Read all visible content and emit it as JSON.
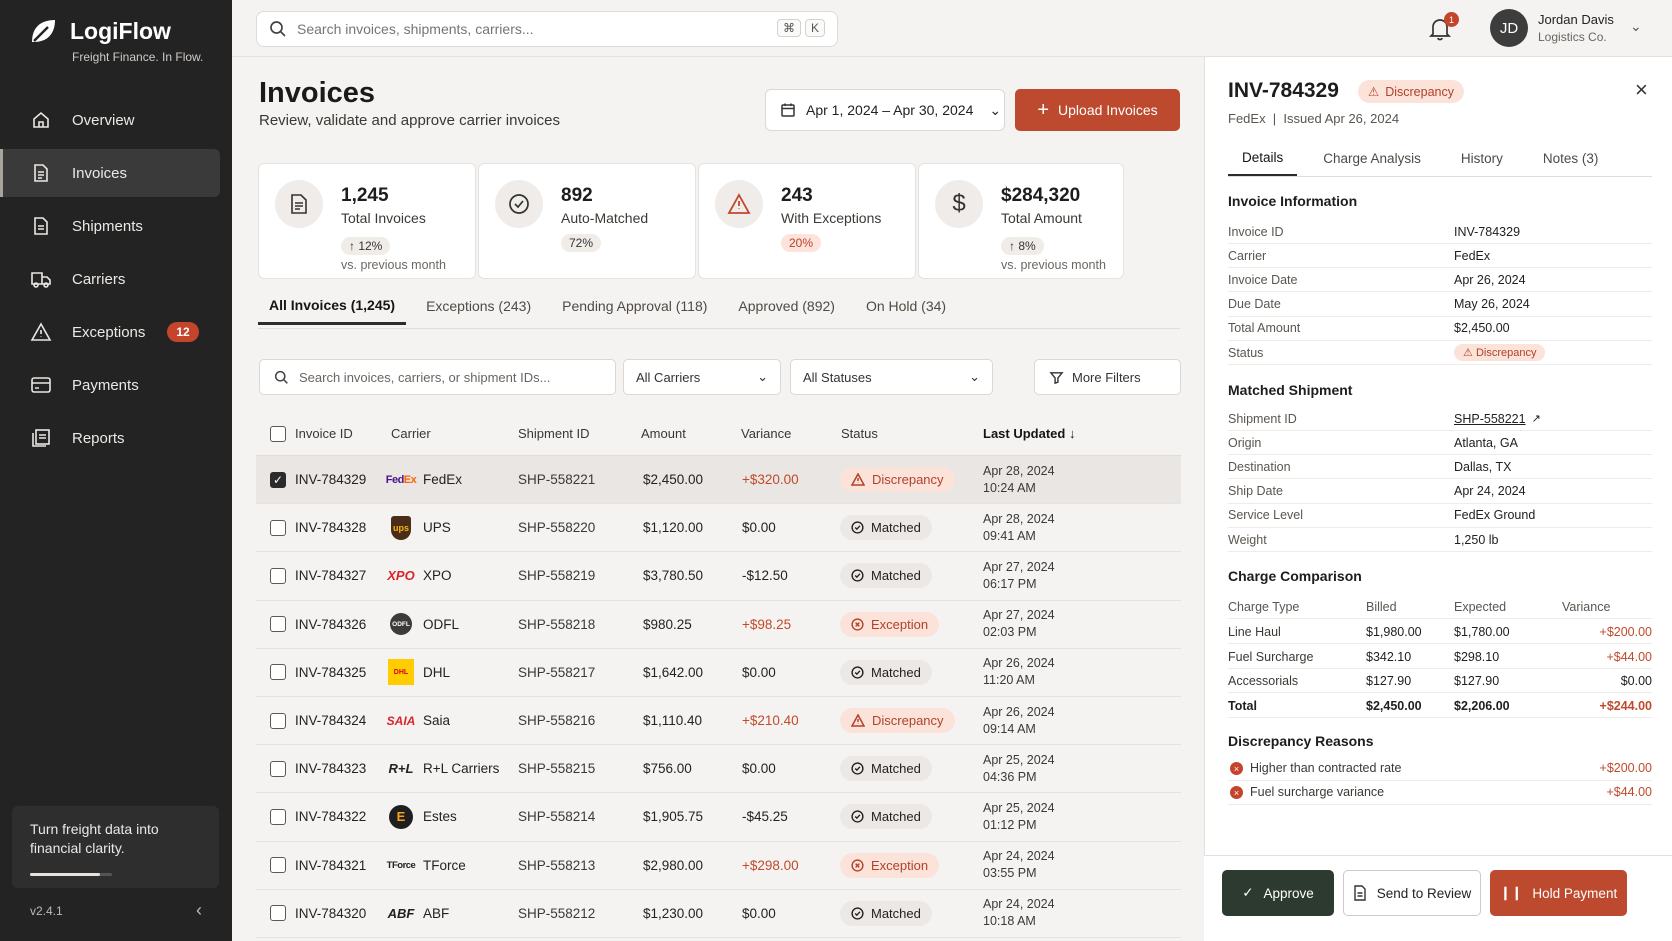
{
  "app": {
    "name": "LogiFlow",
    "tagline": "Freight Finance. In Flow.",
    "version": "v2.4.1",
    "promo": "Turn freight data into financial clarity.",
    "promo_progress": 0.85
  },
  "nav": [
    {
      "label": "Overview",
      "icon": "home-icon"
    },
    {
      "label": "Invoices",
      "icon": "document-icon",
      "active": true
    },
    {
      "label": "Shipments",
      "icon": "clipboard-icon"
    },
    {
      "label": "Carriers",
      "icon": "truck-icon"
    },
    {
      "label": "Exceptions",
      "icon": "warning-icon",
      "badge": "12"
    },
    {
      "label": "Payments",
      "icon": "card-icon"
    },
    {
      "label": "Reports",
      "icon": "reports-icon"
    }
  ],
  "topbar": {
    "search_placeholder": "Search invoices, shipments, carriers...",
    "kbd1": "⌘",
    "kbd2": "K",
    "notif_count": "1",
    "user_initials": "JD",
    "user_name": "Jordan Davis",
    "user_org": "Logistics Co."
  },
  "page": {
    "title": "Invoices",
    "subtitle": "Review, validate and approve carrier invoices",
    "date_range": "Apr 1, 2024 – Apr 30, 2024",
    "upload_label": "Upload Invoices"
  },
  "stats": [
    {
      "value": "1,245",
      "label": "Total Invoices",
      "pill": "↑ 12%",
      "note": "vs. previous month",
      "icon": "document-icon"
    },
    {
      "value": "892",
      "label": "Auto-Matched",
      "pill": "72%",
      "note": "",
      "icon": "check-circle-icon"
    },
    {
      "value": "243",
      "label": "With Exceptions",
      "pill": "20%",
      "note": "",
      "icon": "warning-icon"
    },
    {
      "value": "$284,320",
      "label": "Total Amount",
      "pill": "↑ 8%",
      "note": "vs. previous month",
      "icon": "dollar-icon"
    }
  ],
  "tabs": [
    "All Invoices (1,245)",
    "Exceptions (243)",
    "Pending Approval (118)",
    "Approved (892)",
    "On Hold (34)"
  ],
  "filters": {
    "search_placeholder": "Search invoices, carriers, or shipment IDs...",
    "carriers": "All Carriers",
    "statuses": "All Statuses",
    "more": "More Filters"
  },
  "columns": [
    "Invoice ID",
    "Carrier",
    "Shipment ID",
    "Amount",
    "Variance",
    "Status",
    "Last Updated"
  ],
  "rows": [
    {
      "id": "INV-784329",
      "carrier": "FedEx",
      "logo": "FedEx",
      "shipment": "SHP-558221",
      "amount": "$2,450.00",
      "variance": "+$320.00",
      "status": "Discrepancy",
      "date": "Apr 28, 2024",
      "time": "10:24 AM",
      "selected": true
    },
    {
      "id": "INV-784328",
      "carrier": "UPS",
      "logo": "ups",
      "shipment": "SHP-558220",
      "amount": "$1,120.00",
      "variance": "$0.00",
      "status": "Matched",
      "date": "Apr 28, 2024",
      "time": "09:41 AM"
    },
    {
      "id": "INV-784327",
      "carrier": "XPO",
      "logo": "XPO",
      "shipment": "SHP-558219",
      "amount": "$3,780.50",
      "variance": "-$12.50",
      "status": "Matched",
      "date": "Apr 27, 2024",
      "time": "06:17 PM"
    },
    {
      "id": "INV-784326",
      "carrier": "ODFL",
      "logo": "ODFL",
      "shipment": "SHP-558218",
      "amount": "$980.25",
      "variance": "+$98.25",
      "status": "Exception",
      "date": "Apr 27, 2024",
      "time": "02:03 PM"
    },
    {
      "id": "INV-784325",
      "carrier": "DHL",
      "logo": "DHL",
      "shipment": "SHP-558217",
      "amount": "$1,642.00",
      "variance": "$0.00",
      "status": "Matched",
      "date": "Apr 26, 2024",
      "time": "11:20 AM"
    },
    {
      "id": "INV-784324",
      "carrier": "Saia",
      "logo": "SAIA",
      "shipment": "SHP-558216",
      "amount": "$1,110.40",
      "variance": "+$210.40",
      "status": "Discrepancy",
      "date": "Apr 26, 2024",
      "time": "09:14 AM"
    },
    {
      "id": "INV-784323",
      "carrier": "R+L Carriers",
      "logo": "R+L",
      "shipment": "SHP-558215",
      "amount": "$756.00",
      "variance": "$0.00",
      "status": "Matched",
      "date": "Apr 25, 2024",
      "time": "04:36 PM"
    },
    {
      "id": "INV-784322",
      "carrier": "Estes",
      "logo": "E",
      "shipment": "SHP-558214",
      "amount": "$1,905.75",
      "variance": "-$45.25",
      "status": "Matched",
      "date": "Apr 25, 2024",
      "time": "01:12 PM"
    },
    {
      "id": "INV-784321",
      "carrier": "TForce",
      "logo": "TForce",
      "shipment": "SHP-558213",
      "amount": "$2,980.00",
      "variance": "+$298.00",
      "status": "Exception",
      "date": "Apr 24, 2024",
      "time": "03:55 PM"
    },
    {
      "id": "INV-784320",
      "carrier": "ABF",
      "logo": "ABF",
      "shipment": "SHP-558212",
      "amount": "$1,230.00",
      "variance": "$0.00",
      "status": "Matched",
      "date": "Apr 24, 2024",
      "time": "10:18 AM"
    }
  ],
  "panel": {
    "title": "INV-784329",
    "badge": "Discrepancy",
    "carrier": "FedEx",
    "issued": "Issued Apr 26, 2024",
    "tabs": [
      "Details",
      "Charge Analysis",
      "History",
      "Notes (3)"
    ],
    "info_title": "Invoice Information",
    "info": [
      {
        "k": "Invoice ID",
        "v": "INV-784329"
      },
      {
        "k": "Carrier",
        "v": "FedEx"
      },
      {
        "k": "Invoice Date",
        "v": "Apr 26, 2024"
      },
      {
        "k": "Due Date",
        "v": "May 26, 2024"
      },
      {
        "k": "Total Amount",
        "v": "$2,450.00"
      },
      {
        "k": "Status",
        "v": "Discrepancy"
      }
    ],
    "ship_title": "Matched Shipment",
    "ship": [
      {
        "k": "Shipment ID",
        "v": "SHP-558221"
      },
      {
        "k": "Origin",
        "v": "Atlanta, GA"
      },
      {
        "k": "Destination",
        "v": "Dallas, TX"
      },
      {
        "k": "Ship Date",
        "v": "Apr 24, 2024"
      },
      {
        "k": "Service Level",
        "v": "FedEx Ground"
      },
      {
        "k": "Weight",
        "v": "1,250 lb"
      }
    ],
    "charge_title": "Charge Comparison",
    "charge_head": [
      "Charge Type",
      "Billed",
      "Expected",
      "Variance"
    ],
    "charges": [
      [
        "Line Haul",
        "$1,980.00",
        "$1,780.00",
        "+$200.00"
      ],
      [
        "Fuel Surcharge",
        "$342.10",
        "$298.10",
        "+$44.00"
      ],
      [
        "Accessorials",
        "$127.90",
        "$127.90",
        "$0.00"
      ],
      [
        "Total",
        "$2,450.00",
        "$2,206.00",
        "+$244.00"
      ]
    ],
    "reasons_title": "Discrepancy Reasons",
    "reasons": [
      {
        "label": "Higher than contracted rate",
        "amount": "+$200.00"
      },
      {
        "label": "Fuel surcharge variance",
        "amount": "+$44.00"
      }
    ],
    "actions": {
      "approve": "Approve",
      "review": "Send to Review",
      "hold": "Hold Payment"
    }
  }
}
